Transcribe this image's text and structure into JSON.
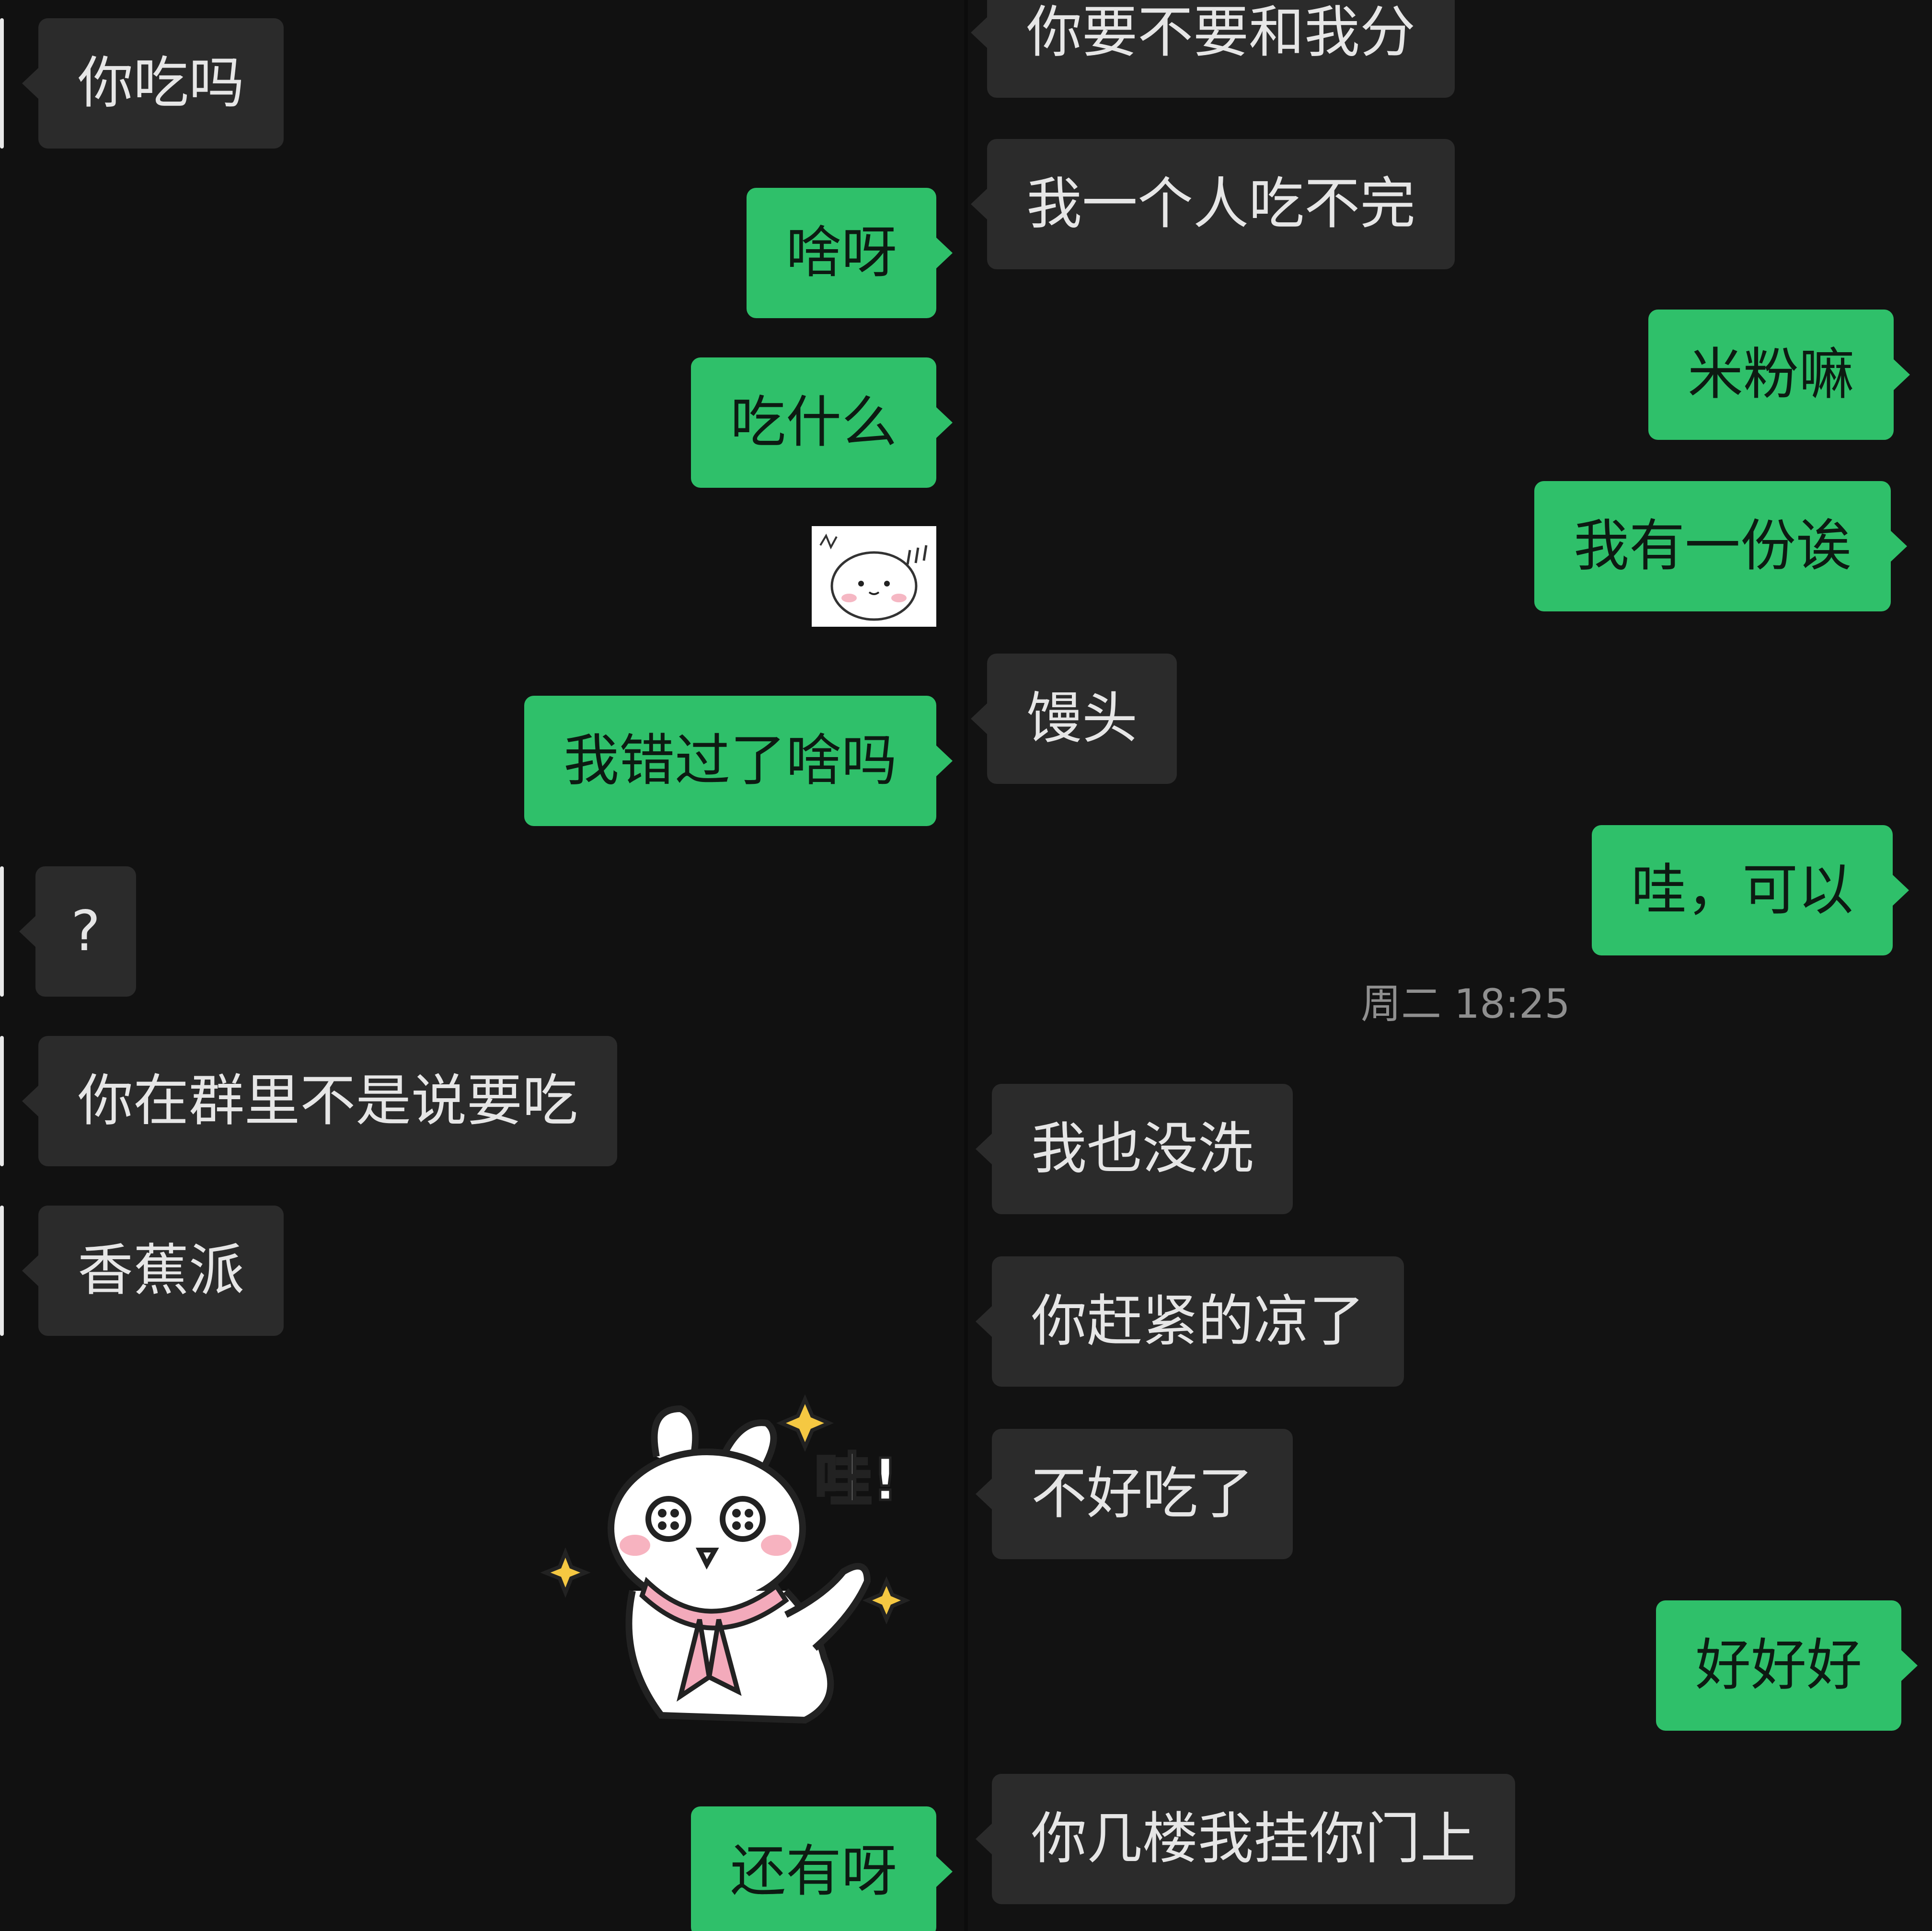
{
  "left_panel": {
    "messages": [
      {
        "side": "in",
        "text": "你吃吗"
      },
      {
        "side": "out",
        "text": "啥呀"
      },
      {
        "side": "out",
        "text": "吃什么"
      },
      {
        "side": "out",
        "type": "sticker",
        "sticker": "small-bun-sticker"
      },
      {
        "side": "out",
        "text": "我错过了啥吗"
      },
      {
        "side": "in",
        "text": "?"
      },
      {
        "side": "in",
        "text": "你在群里不是说要吃"
      },
      {
        "side": "in",
        "text": "香蕉派"
      },
      {
        "side": "out",
        "type": "sticker",
        "sticker": "rabbit-wow-sticker",
        "sticker_text": "哇!"
      },
      {
        "side": "out",
        "text": "还有呀"
      }
    ]
  },
  "right_panel": {
    "timestamp": "周二 18:25",
    "messages": [
      {
        "side": "in",
        "text": "你要不要和我分"
      },
      {
        "side": "in",
        "text": "我一个人吃不完"
      },
      {
        "side": "out",
        "text": "米粉嘛"
      },
      {
        "side": "out",
        "text": "我有一份诶"
      },
      {
        "side": "in",
        "text": "馒头"
      },
      {
        "side": "out",
        "text": "哇，可以"
      },
      {
        "side": "in",
        "text": "我也没洗"
      },
      {
        "side": "in",
        "text": "你赶紧的凉了"
      },
      {
        "side": "in",
        "text": "不好吃了"
      },
      {
        "side": "out",
        "text": "好好好"
      },
      {
        "side": "in",
        "text": "你几楼我挂你门上"
      }
    ]
  },
  "colors": {
    "background": "#111111",
    "incoming_bubble": "#2b2b2b",
    "outgoing_bubble": "#2fc06a",
    "incoming_text": "#e6e6e6",
    "outgoing_text": "#0d1a12",
    "timestamp_text": "#8f8f8f"
  }
}
